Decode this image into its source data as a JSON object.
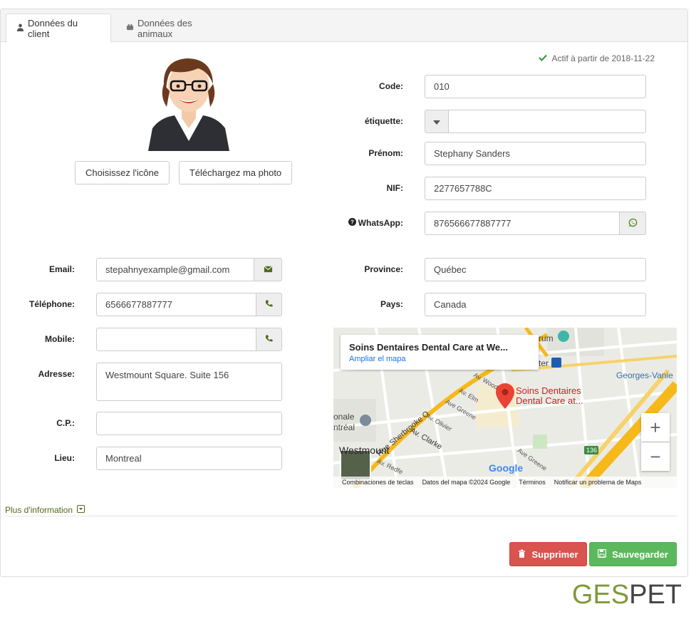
{
  "tabs": [
    {
      "label": "Données du client",
      "icon": "user-icon",
      "active": true
    },
    {
      "label": "Données des animaux",
      "icon": "paw-icon",
      "active": false
    }
  ],
  "status": {
    "text": "Actif à partir de 2018-11-22",
    "color": "#3c9a3c"
  },
  "avatar": {
    "choose_icon_label": "Choisissez l'icône",
    "upload_photo_label": "Téléchargez ma photo"
  },
  "form_right": {
    "code": {
      "label": "Code:",
      "value": "010"
    },
    "tag": {
      "label": "étiquette:",
      "value": ""
    },
    "first_name": {
      "label": "Prénom:",
      "value": "Stephany Sanders"
    },
    "nif": {
      "label": "NIF:",
      "value": "2277657788C"
    },
    "whatsapp": {
      "label": "WhatsApp:",
      "value": "876566677887777"
    },
    "province": {
      "label": "Province:",
      "value": "Québec"
    },
    "country": {
      "label": "Pays:",
      "value": "Canada"
    }
  },
  "form_left": {
    "email": {
      "label": "Email:",
      "value": "stepahnyexample@gmail.com"
    },
    "phone": {
      "label": "Téléphone:",
      "value": "6566677887777"
    },
    "mobile": {
      "label": "Mobile:",
      "value": ""
    },
    "address": {
      "label": "Adresse:",
      "value": "Westmount Square. Suite 156"
    },
    "postal": {
      "label": "C.P.:",
      "value": ""
    },
    "city": {
      "label": "Lieu:",
      "value": "Montreal"
    }
  },
  "map": {
    "card_title": "Soins Dentaires Dental Care at We...",
    "card_link": "Ampliar el mapa",
    "marker_label_1": "Soins Dentaires",
    "marker_label_2": "Dental Care at...",
    "streets": [
      "Rue Sherbrooke O",
      "Av. Clarke",
      "Av. Olivier",
      "Ave Greene",
      "Av. Elm",
      "Av. Wood",
      "Westmount",
      "Georges-Vanie",
      "onale",
      "ntréal",
      "rum",
      "ter",
      "Av. Redfe",
      "136",
      "Ave Greene"
    ],
    "footer": [
      "Combinaciones de teclas",
      "Datos del mapa ©2024 Google",
      "Términos",
      "Notificar un problema de Maps"
    ],
    "google": "Google",
    "zoom_in": "+",
    "zoom_out": "−"
  },
  "more_info": "Plus d'information",
  "buttons": {
    "delete": "Supprimer",
    "save": "Sauvegarder"
  },
  "logo": {
    "part1": "GES",
    "part2": "PET"
  },
  "colors": {
    "accent_green": "#4e6b1a",
    "danger": "#d9534f",
    "success": "#5cb85c"
  }
}
